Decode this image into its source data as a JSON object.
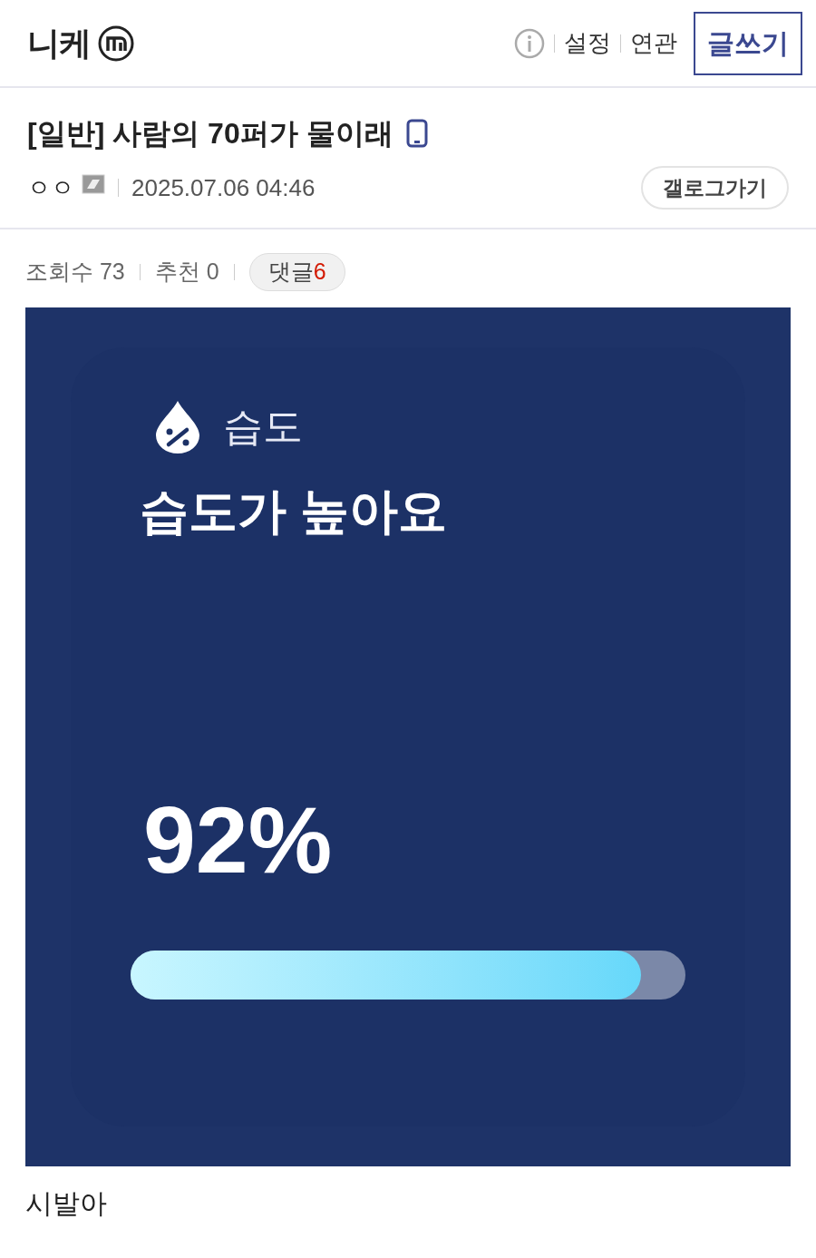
{
  "header": {
    "gallery_name": "니케",
    "links": [
      "설정",
      "연관"
    ],
    "write_button": "글쓰기"
  },
  "post": {
    "title": "[일반] 사람의 70퍼가 물이래",
    "author": "ㅇㅇ",
    "date": "2025.07.06 04:46",
    "gallery_button": "갤로그가기",
    "stats": [
      {
        "label": "조회수",
        "value": "73"
      },
      {
        "label": "추천",
        "value": "0"
      }
    ],
    "comments": {
      "label": "댓글",
      "count": "6"
    }
  },
  "widget": {
    "label": "습도",
    "status": "습도가 높아요",
    "reading": "92%",
    "level": 0.92
  },
  "body": "시발아"
}
